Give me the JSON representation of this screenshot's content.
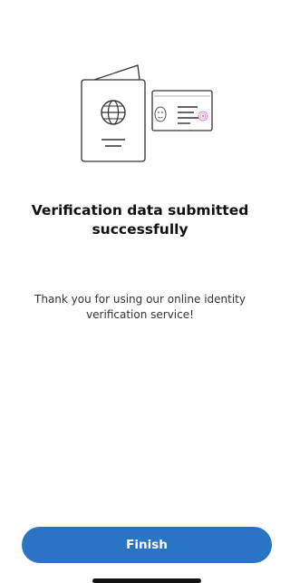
{
  "illustration": {
    "icon": "passport-and-id-card-icon"
  },
  "result": {
    "title": "Verification data submitted successfully",
    "message": "Thank you for using our online identity verification service!"
  },
  "actions": {
    "finish_label": "Finish"
  },
  "colors": {
    "primary": "#2a74c4",
    "stamp": "#d98ad0"
  }
}
